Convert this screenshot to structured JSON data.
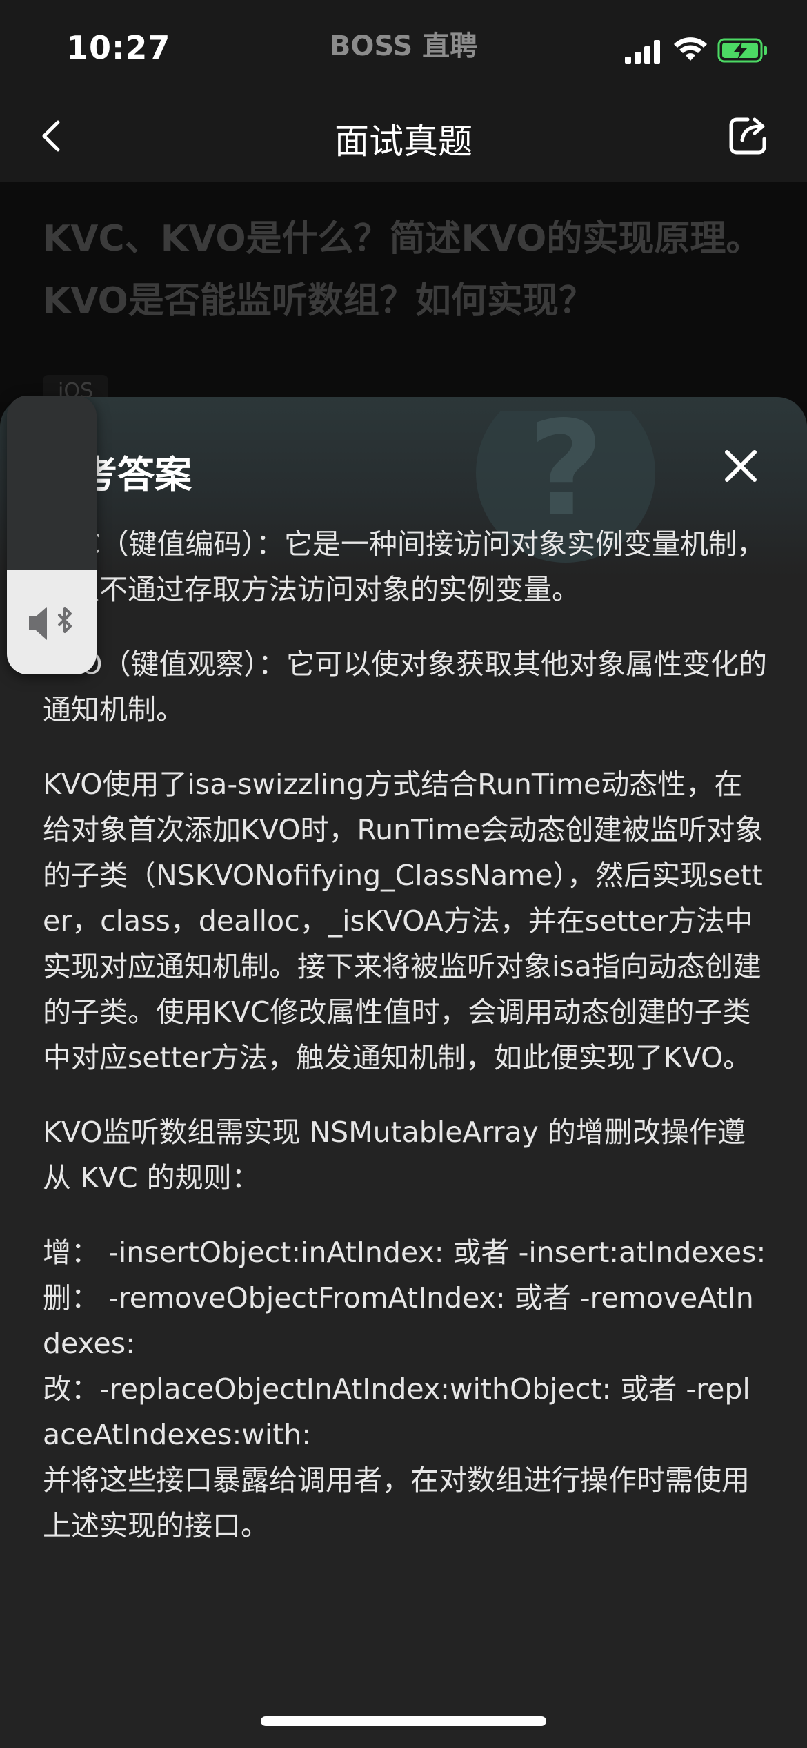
{
  "status_bar": {
    "time": "10:27",
    "app_name": "BOSS 直聘"
  },
  "nav": {
    "title": "面试真题",
    "back_icon": "chevron-left-icon",
    "share_icon": "share-icon"
  },
  "question": {
    "title": "KVC、KVO是什么？简述KVO的实现原理。KVO是否能监听数组？如何实现？",
    "tag": "iOS"
  },
  "answer_sheet": {
    "title": "参考答案",
    "close_icon": "close-icon",
    "paragraphs": [
      "KVC（键值编码）：它是一种间接访问对象实例变量机制，可以不通过存取方法访问对象的实例变量。",
      "KVO（键值观察）：它可以使对象获取其他对象属性变化的通知机制。",
      "KVO使用了isa-swizzling方式结合RunTime动态性，在给对象首次添加KVO时，RunTime会动态创建被监听对象的子类（NSKVONofifying_ClassName），然后实现setter，class，dealloc，_isKVOA方法，并在setter方法中实现对应通知机制。接下来将被监听对象isa指向动态创建的子类。使用KVC修改属性值时，会调用动态创建的子类中对应setter方法，触发通知机制，如此便实现了KVO。",
      "KVO监听数组需实现 NSMutableArray 的增删改操作遵从 KVC 的规则：",
      "增： -insertObject:inAtIndex: 或者 -insert:atIndexes:\n删： -removeObjectFromAtIndex: 或者 -removeAtIndexes:\n改：-replaceObjectInAtIndex:withObject: 或者 -replaceAtIndexes:with:\n并将这些接口暴露给调用者，在对数组进行操作时需使用上述实现的接口。"
    ]
  },
  "audio_widget": {
    "icon": "speaker-bluetooth-icon"
  },
  "colors": {
    "background": "#0b0b0b",
    "bar": "#1a1a1a",
    "sheet": "#232323",
    "battery_green": "#4cd964"
  }
}
